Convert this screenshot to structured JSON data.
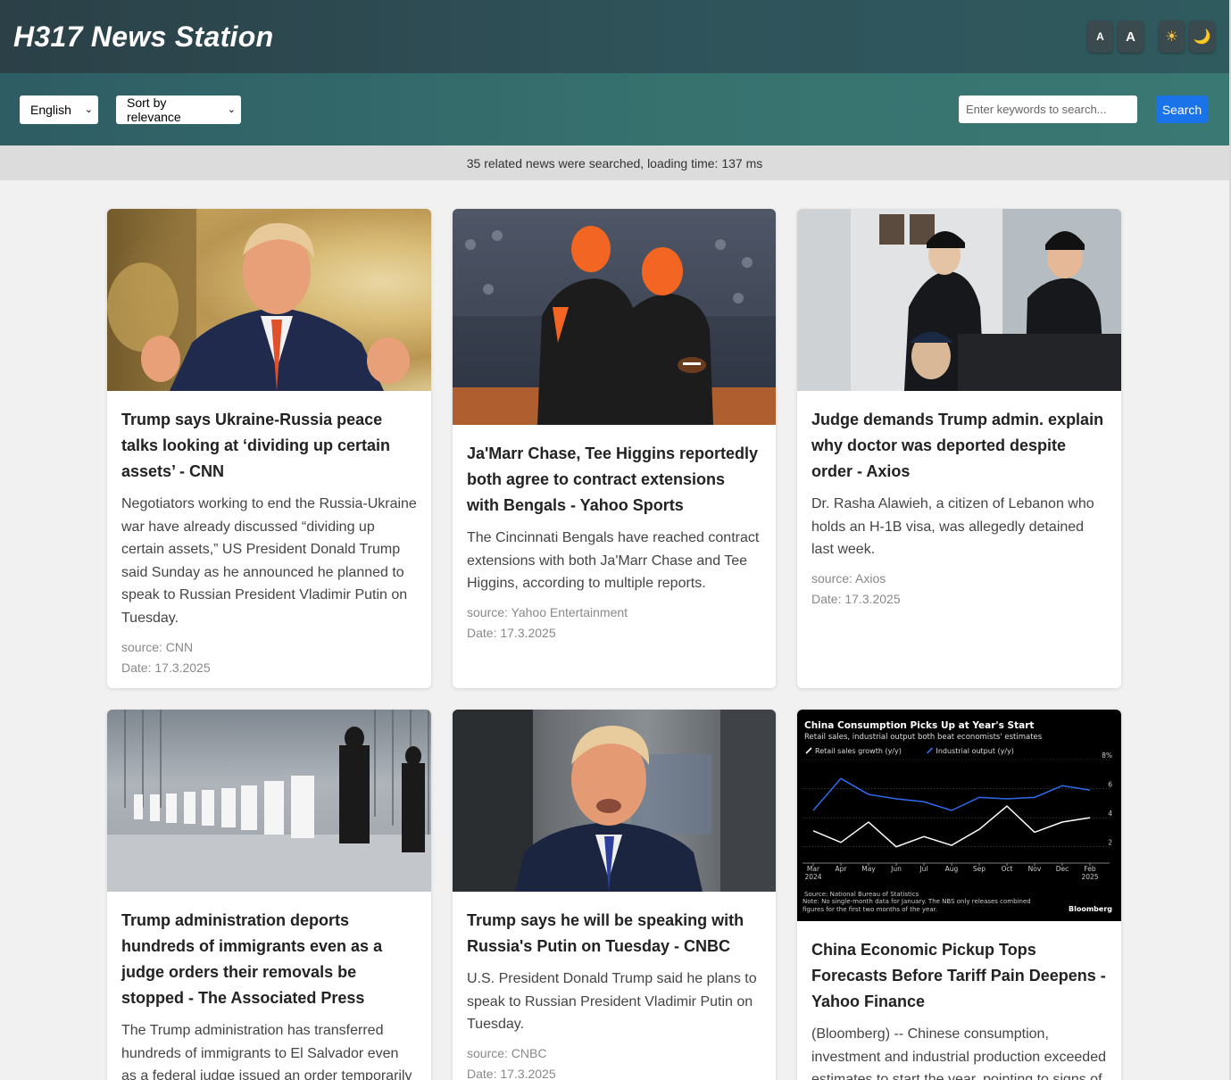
{
  "header": {
    "title": "H317 News Station",
    "font_small_label": "A",
    "font_large_label": "A",
    "light_theme_glyph": "☀",
    "dark_theme_glyph": "🌙"
  },
  "toolbar": {
    "language_selected": "English",
    "sort_selected": "Sort by relevance",
    "search_placeholder": "Enter keywords to search...",
    "search_button": "Search"
  },
  "status": {
    "text": "35 related news were searched, loading time: 137 ms"
  },
  "articles": [
    {
      "title": "Trump says Ukraine-Russia peace talks looking at ‘dividing up certain assets’ - CNN",
      "description": "Negotiators working to end the Russia-Ukraine war have already discussed “dividing up certain assets,” US President Donald Trump said Sunday as he announced he planned to speak to Russian President Vladimir Putin on Tuesday.",
      "source": "source: CNN",
      "date": "Date: 17.3.2025",
      "image": "photo-trump-oval-office"
    },
    {
      "title": "Ja'Marr Chase, Tee Higgins reportedly both agree to contract extensions with Bengals - Yahoo Sports",
      "description": "The Cincinnati Bengals have reached contract extensions with both Ja'Marr Chase and Tee Higgins, according to multiple reports.",
      "source": "source: Yahoo Entertainment",
      "date": "Date: 17.3.2025",
      "image": "photo-bengals-players"
    },
    {
      "title": "Judge demands Trump admin. explain why doctor was deported despite order - Axios",
      "description": "Dr. Rasha Alawieh, a citizen of Lebanon who holds an H-1B visa, was allegedly detained last week.",
      "source": "source: Axios",
      "date": "Date: 17.3.2025",
      "image": "photo-cbp-officers"
    },
    {
      "title": "Trump administration deports hundreds of immigrants even as a judge orders their removals be stopped - The Associated Press",
      "description": "The Trump administration has transferred hundreds of immigrants to El Salvador even as a federal judge issued an order temporarily",
      "image": "photo-prison-transfer"
    },
    {
      "title": "Trump says he will be speaking with Russia's Putin on Tuesday - CNBC",
      "description": "U.S. President Donald Trump said he plans to speak to Russian President Vladimir Putin on Tuesday.",
      "source": "source: CNBC",
      "date": "Date: 17.3.2025",
      "image": "photo-trump-plane"
    },
    {
      "title": "China Economic Pickup Tops Forecasts Before Tariff Pain Deepens - Yahoo Finance",
      "description": "(Bloomberg) -- Chinese consumption, investment and industrial production exceeded estimates to start the year, pointing to signs of",
      "image": "chart-china-consumption"
    }
  ],
  "chart_data": {
    "type": "line",
    "title": "China Consumption Picks Up at Year's Start",
    "subtitle": "Retail sales, industrial output both beat economists' estimates",
    "x": [
      "Mar 2024",
      "Apr",
      "May",
      "Jun",
      "Jul",
      "Aug",
      "Sep",
      "Oct",
      "Nov",
      "Dec",
      "Feb 2025"
    ],
    "x_tick_top": [
      "Mar",
      "Apr",
      "May",
      "Jun",
      "Jul",
      "Aug",
      "Sep",
      "Oct",
      "Nov",
      "Dec",
      "Feb"
    ],
    "x_tick_bottom": [
      "2024",
      "",
      "",
      "",
      "",
      "",
      "",
      "",
      "",
      "",
      "2025"
    ],
    "y_ticks": [
      "8%",
      "6",
      "4",
      "2"
    ],
    "ylim": [
      1,
      8
    ],
    "series": [
      {
        "name": "Retail sales growth (y/y)",
        "color": "#ffffff",
        "values": [
          3.1,
          2.3,
          3.7,
          2.0,
          2.7,
          2.1,
          3.2,
          4.8,
          3.0,
          3.7,
          4.0
        ]
      },
      {
        "name": "Industrial output (y/y)",
        "color": "#2d6cf0",
        "values": [
          4.5,
          6.7,
          5.6,
          5.3,
          5.1,
          4.5,
          5.4,
          5.3,
          5.4,
          6.2,
          5.9
        ]
      }
    ],
    "source_note": "Source: National Bureau of Statistics",
    "note": "Note: No single-month data for January. The NBS only releases combined figures for the first two months of the year.",
    "brand": "Bloomberg"
  }
}
